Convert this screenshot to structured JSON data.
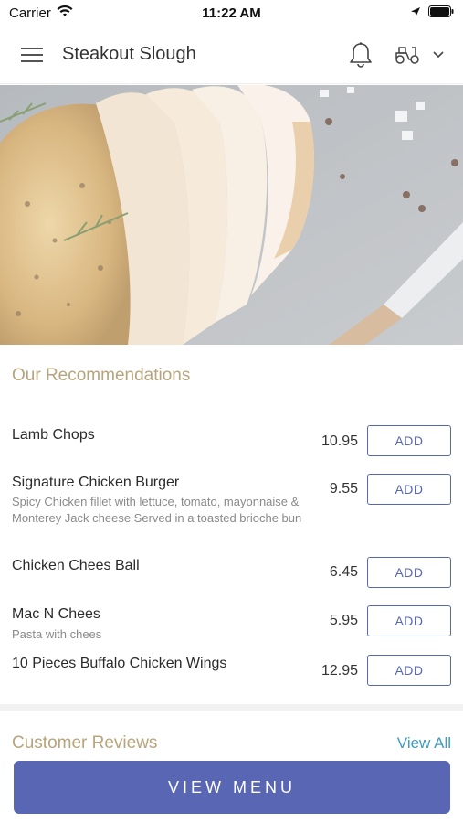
{
  "status_bar": {
    "carrier": "Carrier",
    "time": "11:22 AM"
  },
  "header": {
    "title": "Steakout Slough",
    "icons": [
      "menu-icon",
      "bell-icon",
      "scooter-icon",
      "chevron-down-icon"
    ]
  },
  "recommendations": {
    "title": "Our Recommendations",
    "add_label": "ADD",
    "items": [
      {
        "name": "Lamb Chops",
        "description": "",
        "price": "10.95"
      },
      {
        "name": "Signature Chicken Burger",
        "description": "Spicy Chicken fillet with lettuce, tomato, mayonnaise & Monterey Jack cheese  Served in a toasted brioche bun",
        "price": "9.55"
      },
      {
        "name": "Chicken Chees Ball",
        "description": "",
        "price": "6.45"
      },
      {
        "name": "Mac N Chees",
        "description": "Pasta with chees",
        "price": "5.95"
      },
      {
        "name": "10 Pieces Buffalo Chicken Wings",
        "description": "",
        "price": "12.95"
      }
    ]
  },
  "reviews": {
    "title": "Customer Reviews",
    "view_all": "View All"
  },
  "footer": {
    "view_menu": "VIEW MENU"
  },
  "colors": {
    "accent": "#5866b4",
    "section_title": "#b8a47c",
    "link": "#3e9cc0"
  }
}
